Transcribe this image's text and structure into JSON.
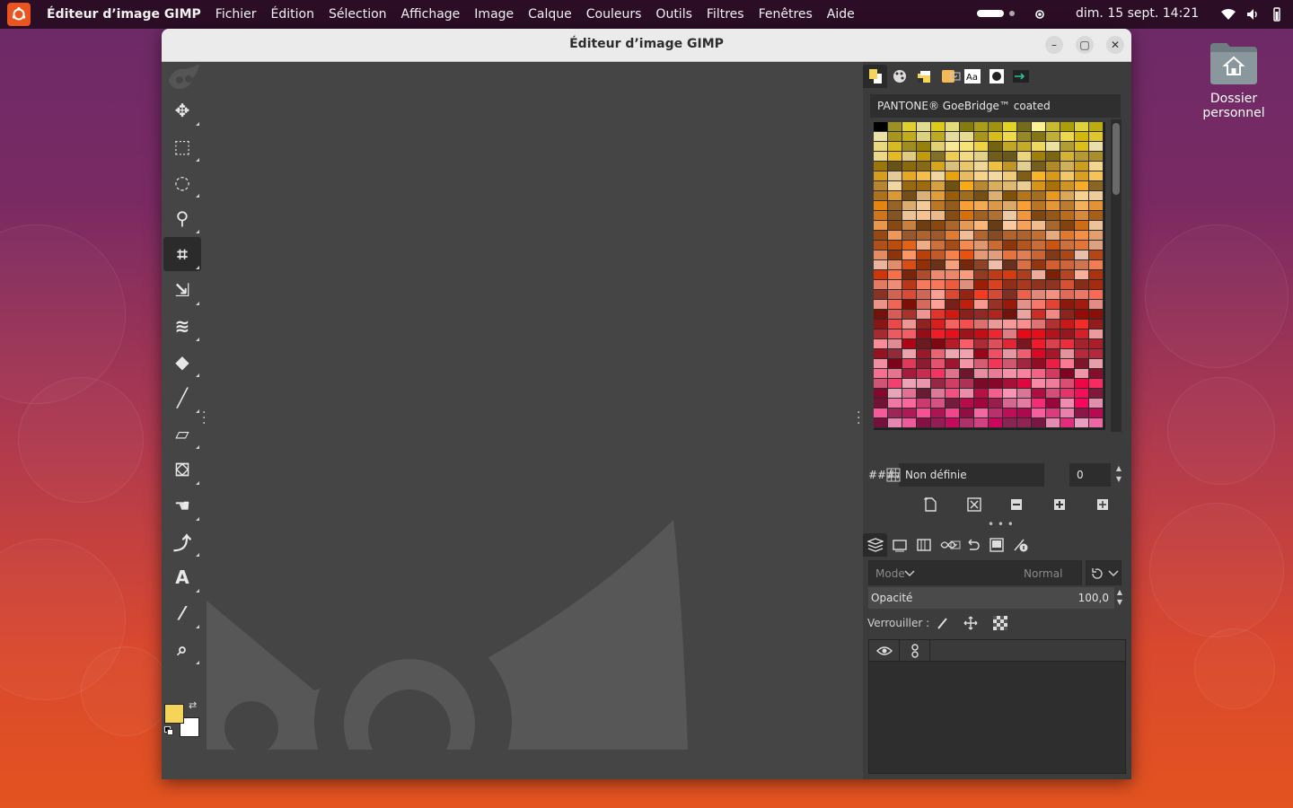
{
  "topbar": {
    "app_name": "Éditeur d’image GIMP",
    "menu": [
      "Fichier",
      "Édition",
      "Sélection",
      "Affichage",
      "Image",
      "Calque",
      "Couleurs",
      "Outils",
      "Filtres",
      "Fenêtres",
      "Aide"
    ],
    "clock": "dim. 15 sept.  14:21"
  },
  "desktop": {
    "home_label": "Dossier personnel"
  },
  "window": {
    "title": "Éditeur d’image GIMP",
    "minimize": "–",
    "maximize": "▢",
    "close": "✕"
  },
  "toolbox": {
    "tools": [
      {
        "name": "move-tool",
        "icon": "✥"
      },
      {
        "name": "rect-select-tool",
        "icon": "⬚"
      },
      {
        "name": "free-select-tool",
        "icon": "◌"
      },
      {
        "name": "fuzzy-select-tool",
        "icon": "⚲"
      },
      {
        "name": "crop-tool",
        "icon": "⌗",
        "active": true
      },
      {
        "name": "transform-tool",
        "icon": "⇲"
      },
      {
        "name": "warp-tool",
        "icon": "≋"
      },
      {
        "name": "bucket-fill-tool",
        "icon": "◆"
      },
      {
        "name": "paintbrush-tool",
        "icon": "╱"
      },
      {
        "name": "eraser-tool",
        "icon": "▱"
      },
      {
        "name": "clone-tool",
        "icon": "⛋"
      },
      {
        "name": "smudge-tool",
        "icon": "☚"
      },
      {
        "name": "paths-tool",
        "icon": "⤴"
      },
      {
        "name": "text-tool",
        "icon": "A"
      },
      {
        "name": "color-picker-tool",
        "icon": "⁄"
      },
      {
        "name": "zoom-tool",
        "icon": "⌕"
      }
    ],
    "fg_color": "#f4d55a",
    "bg_color": "#ffffff"
  },
  "palette_panel": {
    "palette_name": "PANTONE® GoeBridge™ coated",
    "hex_label": "####",
    "color_name": "Non définie",
    "columns_value": "0"
  },
  "layers_panel": {
    "mode_label": "Mode",
    "mode_value": "Normal",
    "opacity_label": "Opacité",
    "opacity_value": "100,0",
    "lock_label": "Verrouiller :"
  }
}
